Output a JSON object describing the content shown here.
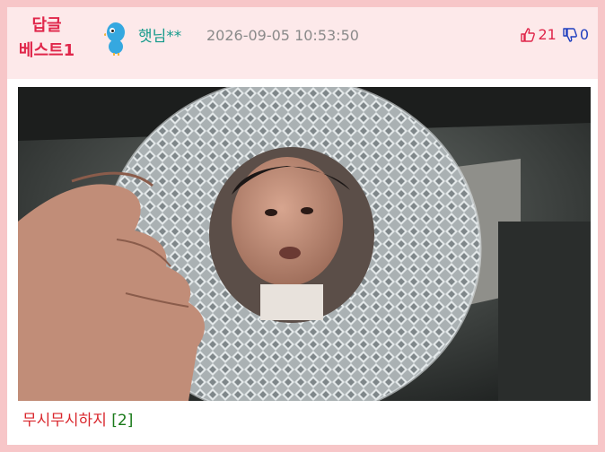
{
  "post": {
    "badge_line1": "답글",
    "badge_line2": "베스트1",
    "username": "햇님**",
    "timestamp": "2026-09-05 10:53:50",
    "upvotes": "21",
    "downvotes": "0",
    "title": "무시무시하지",
    "comment_count": "[2]"
  },
  "icons": {
    "avatar": "bird-avatar-icon",
    "upvote": "thumbs-up-icon",
    "downvote": "thumbs-down-icon"
  },
  "colors": {
    "frame": "#f7c6c8",
    "header_bg": "#fde9ea",
    "badge": "#e0264a",
    "username": "#169b8c",
    "upvote": "#e0264a",
    "downvote": "#1f3fbf",
    "title": "#d9252b",
    "comment_count": "#1a7a1a"
  }
}
